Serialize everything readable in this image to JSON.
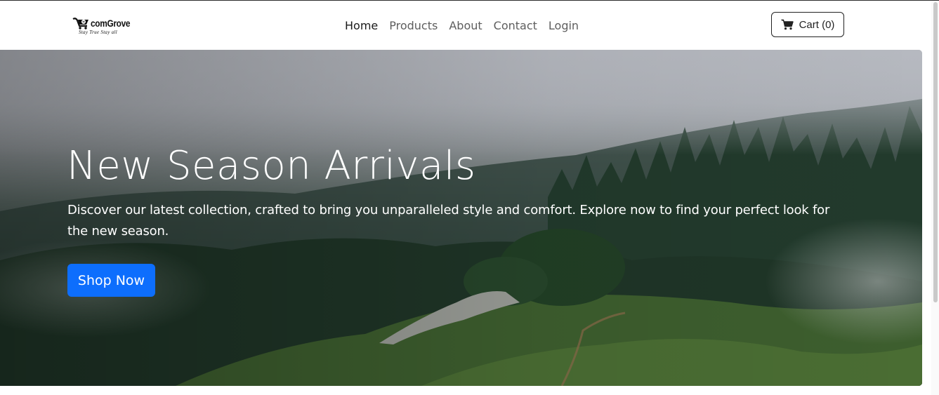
{
  "brand": {
    "name": "comGrove",
    "tagline": "Stay True Stay all"
  },
  "nav": {
    "links": [
      {
        "label": "Home",
        "active": true
      },
      {
        "label": "Products",
        "active": false
      },
      {
        "label": "About",
        "active": false
      },
      {
        "label": "Contact",
        "active": false
      },
      {
        "label": "Login",
        "active": false
      }
    ],
    "cart": {
      "label": "Cart (0)",
      "icon": "shopping-cart-icon"
    }
  },
  "hero": {
    "title": "New Season Arrivals",
    "text": "Discover our latest collection, crafted to bring you unparalleled style and comfort. Explore now to find your perfect look for the new season.",
    "button_label": "Shop Now",
    "background_image": "misty forested mountain slope"
  },
  "colors": {
    "primary": "#0d6efd",
    "nav_active": "#1a1a1a",
    "nav_text": "#5e5e5e"
  }
}
